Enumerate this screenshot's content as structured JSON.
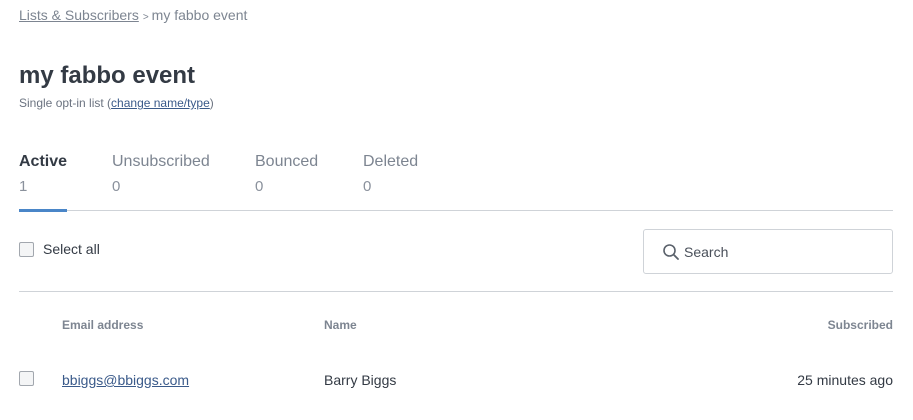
{
  "breadcrumb": {
    "parent": "Lists & Subscribers",
    "separator": ">",
    "current": "my fabbo event"
  },
  "header": {
    "title": "my fabbo event",
    "subtitle_prefix": "Single opt-in list (",
    "subtitle_link": "change name/type",
    "subtitle_suffix": ")"
  },
  "tabs": [
    {
      "label": "Active",
      "count": "1",
      "active": true
    },
    {
      "label": "Unsubscribed",
      "count": "0",
      "active": false
    },
    {
      "label": "Bounced",
      "count": "0",
      "active": false
    },
    {
      "label": "Deleted",
      "count": "0",
      "active": false
    }
  ],
  "toolbar": {
    "select_all_label": "Select all",
    "search_placeholder": "Search",
    "search_icon": "search-icon"
  },
  "table": {
    "columns": [
      "Email address",
      "Name",
      "Subscribed"
    ],
    "rows": [
      {
        "email": "bbiggs@bbiggs.com",
        "name": "Barry Biggs",
        "subscribed": "25 minutes ago"
      }
    ]
  },
  "colors": {
    "accent": "#4a86c8",
    "link": "#3a5a8a",
    "text": "#333a44",
    "muted": "#7d8591"
  }
}
